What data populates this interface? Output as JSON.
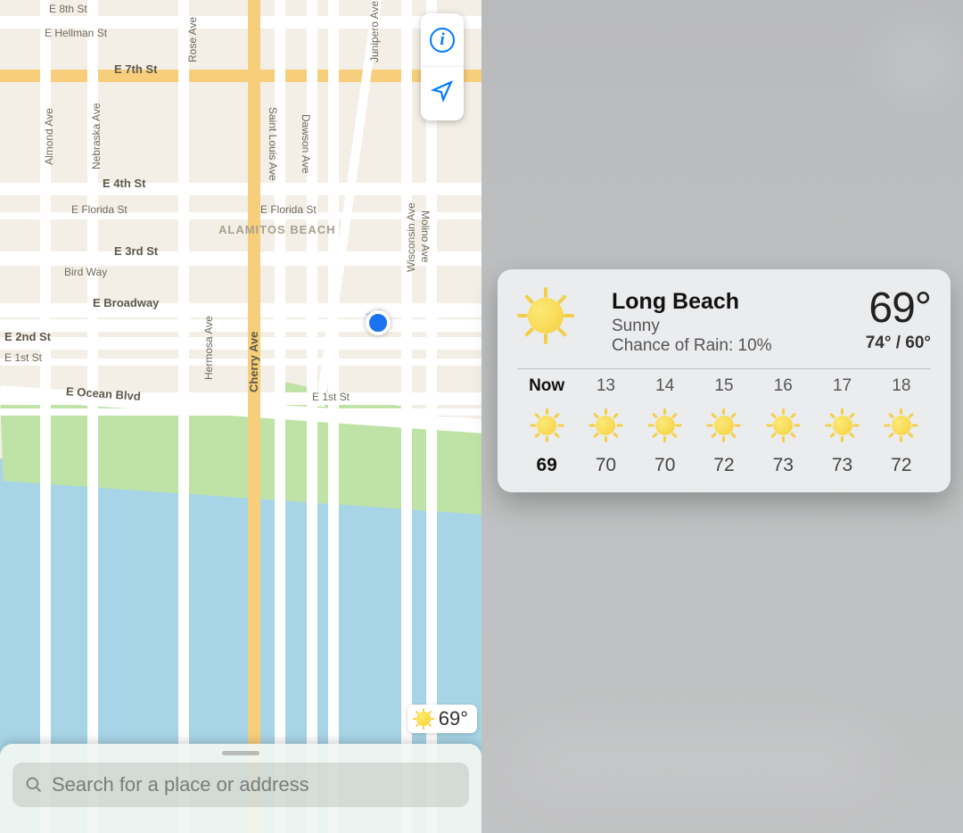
{
  "map": {
    "streets": {
      "e8th": "E 8th St",
      "hellman": "E Hellman St",
      "e7th": "E 7th St",
      "e4th": "E 4th St",
      "florida1": "E Florida St",
      "florida2": "E Florida St",
      "e3rd": "E 3rd St",
      "birdway": "Bird Way",
      "broadway": "E Broadway",
      "e2nd": "E 2nd St",
      "e1st": "E 1st St",
      "e1st_r": "E 1st St",
      "ocean": "E Ocean Blvd",
      "almond": "Almond Ave",
      "nebraska": "Nebraska Ave",
      "rose": "Rose Ave",
      "stlouis": "Saint Louis Ave",
      "dawson": "Dawson Ave",
      "junipero": "Junipero Ave",
      "wisconsin": "Wisconsin Ave",
      "molino": "Molino Ave",
      "cherry": "Cherry Ave",
      "hermosa": "Hermosa Ave"
    },
    "district": "ALAMITOS BEACH",
    "search_placeholder": "Search for a place or address",
    "badge_temp": "69°"
  },
  "weather": {
    "city": "Long Beach",
    "condition": "Sunny",
    "rain": "Chance of Rain: 10%",
    "current": "69°",
    "hilo": "74° / 60°",
    "hours": [
      {
        "label": "Now",
        "temp": "69",
        "now": true
      },
      {
        "label": "13",
        "temp": "70"
      },
      {
        "label": "14",
        "temp": "70"
      },
      {
        "label": "15",
        "temp": "72"
      },
      {
        "label": "16",
        "temp": "73"
      },
      {
        "label": "17",
        "temp": "73"
      },
      {
        "label": "18",
        "temp": "72"
      }
    ]
  }
}
